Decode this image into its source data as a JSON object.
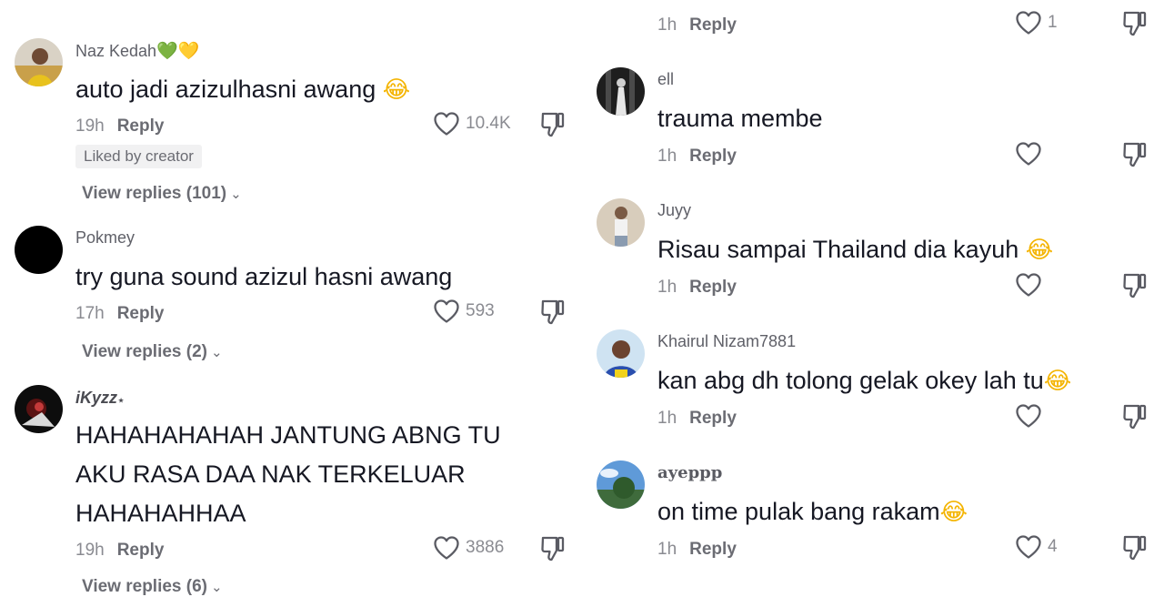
{
  "left_comments": [
    {
      "username": "Naz Kedah",
      "username_emojis": "💚💛",
      "text": "auto jadi azizulhasni awang",
      "text_emoji": "😂",
      "time": "19h",
      "reply_label": "Reply",
      "likes": "10.4K",
      "badge": "Liked by creator",
      "view_replies": "View replies (101)"
    },
    {
      "username": "Pokmey",
      "text": "try guna sound azizul hasni awang",
      "time": "17h",
      "reply_label": "Reply",
      "likes": "593",
      "view_replies": "View replies (2)"
    },
    {
      "username": "iKyzz",
      "username_mark": "⋆",
      "text_lines": [
        "HAHAHAHAHAH JANTUNG ABNG TU",
        "AKU RASA DAA NAK TERKELUAR",
        "HAHAHAHHAA"
      ],
      "time": "19h",
      "reply_label": "Reply",
      "likes": "3886",
      "view_replies": "View replies (6)"
    }
  ],
  "right_comments": [
    {
      "time": "1h",
      "reply_label": "Reply",
      "likes": "1"
    },
    {
      "username": "ell",
      "text": "trauma membe",
      "time": "1h",
      "reply_label": "Reply",
      "likes": ""
    },
    {
      "username": "Juyy",
      "text": "Risau sampai Thailand dia kayuh",
      "text_emoji": "😂",
      "time": "1h",
      "reply_label": "Reply",
      "likes": ""
    },
    {
      "username": "Khairul Nizam7881",
      "text": "kan abg dh tolong gelak okey lah tu",
      "text_emoji": "😂",
      "time": "1h",
      "reply_label": "Reply",
      "likes": ""
    },
    {
      "username": "ayeppp",
      "text": "on time pulak bang rakam",
      "text_emoji": "😂",
      "time": "1h",
      "reply_label": "Reply",
      "likes": "4"
    }
  ],
  "colors": {
    "text": "#161823",
    "secondary": "#8a8b91",
    "reply": "#6b6c73",
    "emoji": "#f4b400",
    "badge_bg": "#f1f1f2"
  },
  "icons": {
    "like": "heart-outline-icon",
    "dislike": "thumbs-down-outline-icon",
    "chevron": "chevron-down-icon"
  }
}
